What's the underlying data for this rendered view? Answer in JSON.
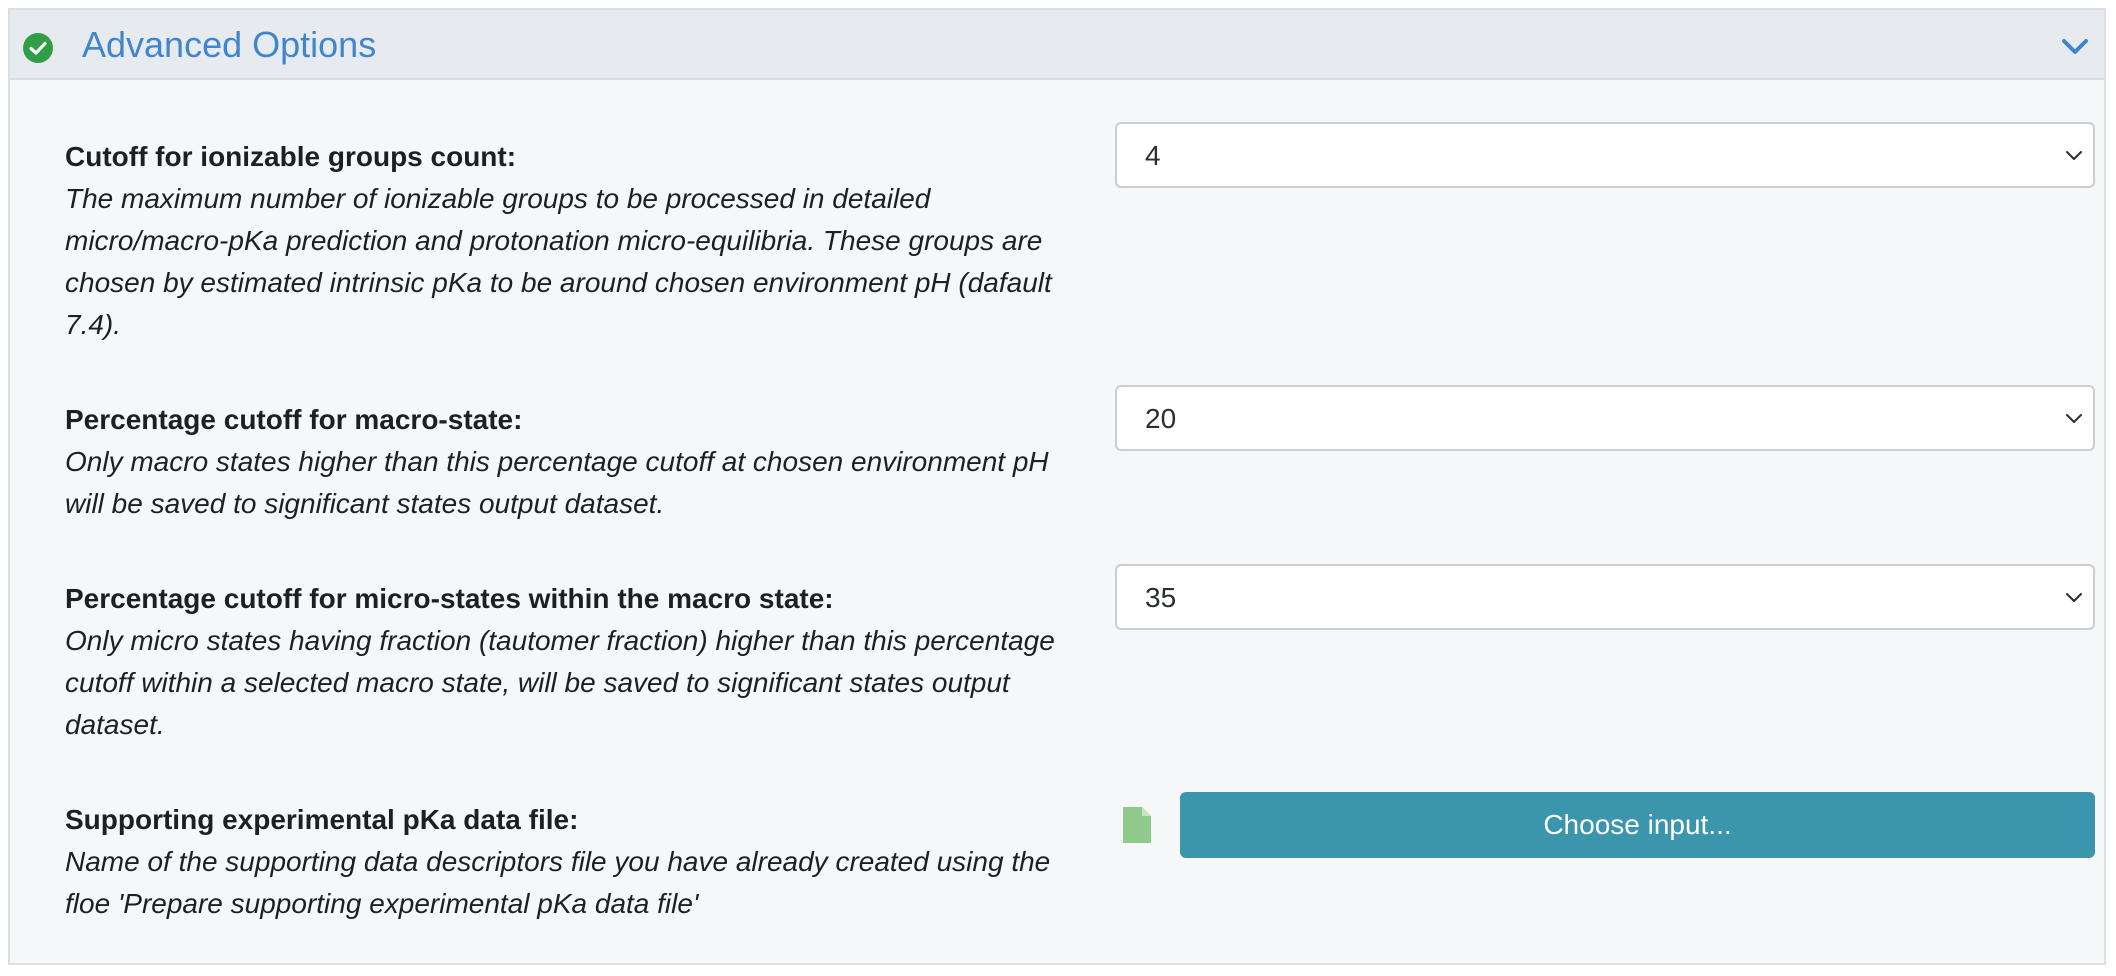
{
  "panel": {
    "title": "Advanced Options",
    "status_icon": "check-circle-icon",
    "collapse_icon": "chevron-down-icon",
    "accent_color": "#3f86cc",
    "status_color": "#2f9e44"
  },
  "fields": [
    {
      "label": "Cutoff for ionizable groups count:",
      "description": "The maximum number of ionizable groups to be processed in detailed micro/macro-pKa prediction and protonation micro-equilibria. These groups are chosen by estimated intrinsic pKa to be around chosen environment pH (dafault 7.4).",
      "value": "4"
    },
    {
      "label": "Percentage cutoff for macro-state:",
      "description": "Only macro states higher than this percentage cutoff at chosen environment pH will be saved to significant states output dataset.",
      "value": "20"
    },
    {
      "label": "Percentage cutoff for micro-states within the macro state:",
      "description": "Only micro states having fraction (tautomer fraction) higher than this percentage cutoff within a selected macro state, will be saved to significant states output dataset.",
      "value": "35"
    },
    {
      "label": "Supporting experimental pKa data file:",
      "description": "Name of the supporting data descriptors file you have already created using the floe 'Prepare supporting experimental pKa data file'",
      "button_label": "Choose input...",
      "button_color": "#3a95ad",
      "file_icon": "file-icon"
    }
  ]
}
